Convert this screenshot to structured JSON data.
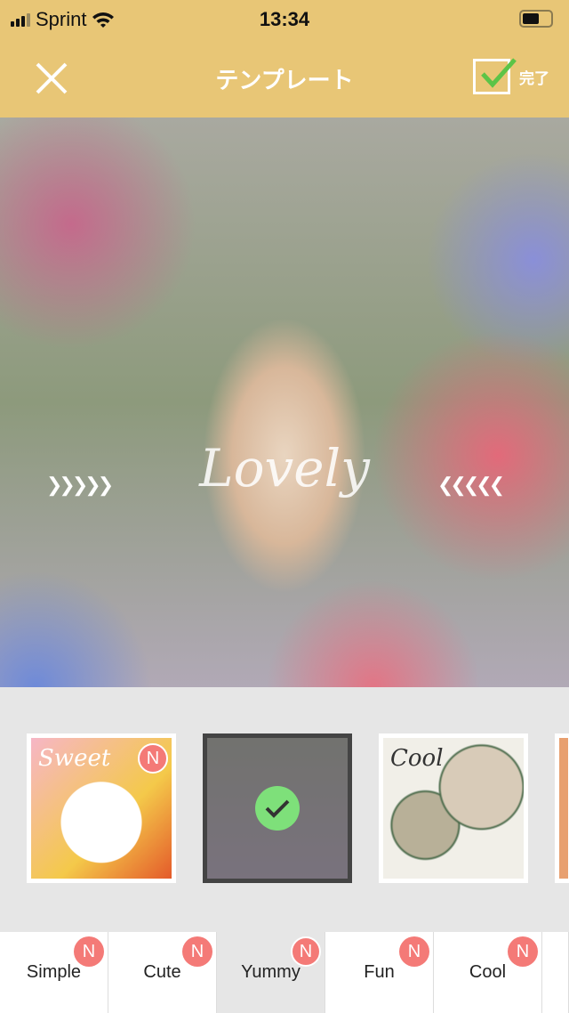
{
  "status_bar": {
    "carrier": "Sprint",
    "time": "13:34",
    "battery_level": 0.6
  },
  "nav": {
    "title": "テンプレート",
    "done_label": "完了",
    "close_icon": "close-icon",
    "done_icon": "checkbox-checked-icon"
  },
  "colors": {
    "header": "#e8c676",
    "badge": "#f47a77",
    "check": "#7ee07a"
  },
  "preview": {
    "overlay_text": "Lovely"
  },
  "templates": [
    {
      "label": "Sweet",
      "badge": "N",
      "selected": false
    },
    {
      "label": "",
      "badge": "",
      "selected": true
    },
    {
      "label": "Cool",
      "badge": "",
      "selected": false
    }
  ],
  "tabs": [
    {
      "label": "Simple",
      "badge": "N"
    },
    {
      "label": "Cute",
      "badge": "N"
    },
    {
      "label": "Yummy",
      "badge": "N",
      "active": true
    },
    {
      "label": "Fun",
      "badge": "N"
    },
    {
      "label": "Cool",
      "badge": "N"
    }
  ]
}
